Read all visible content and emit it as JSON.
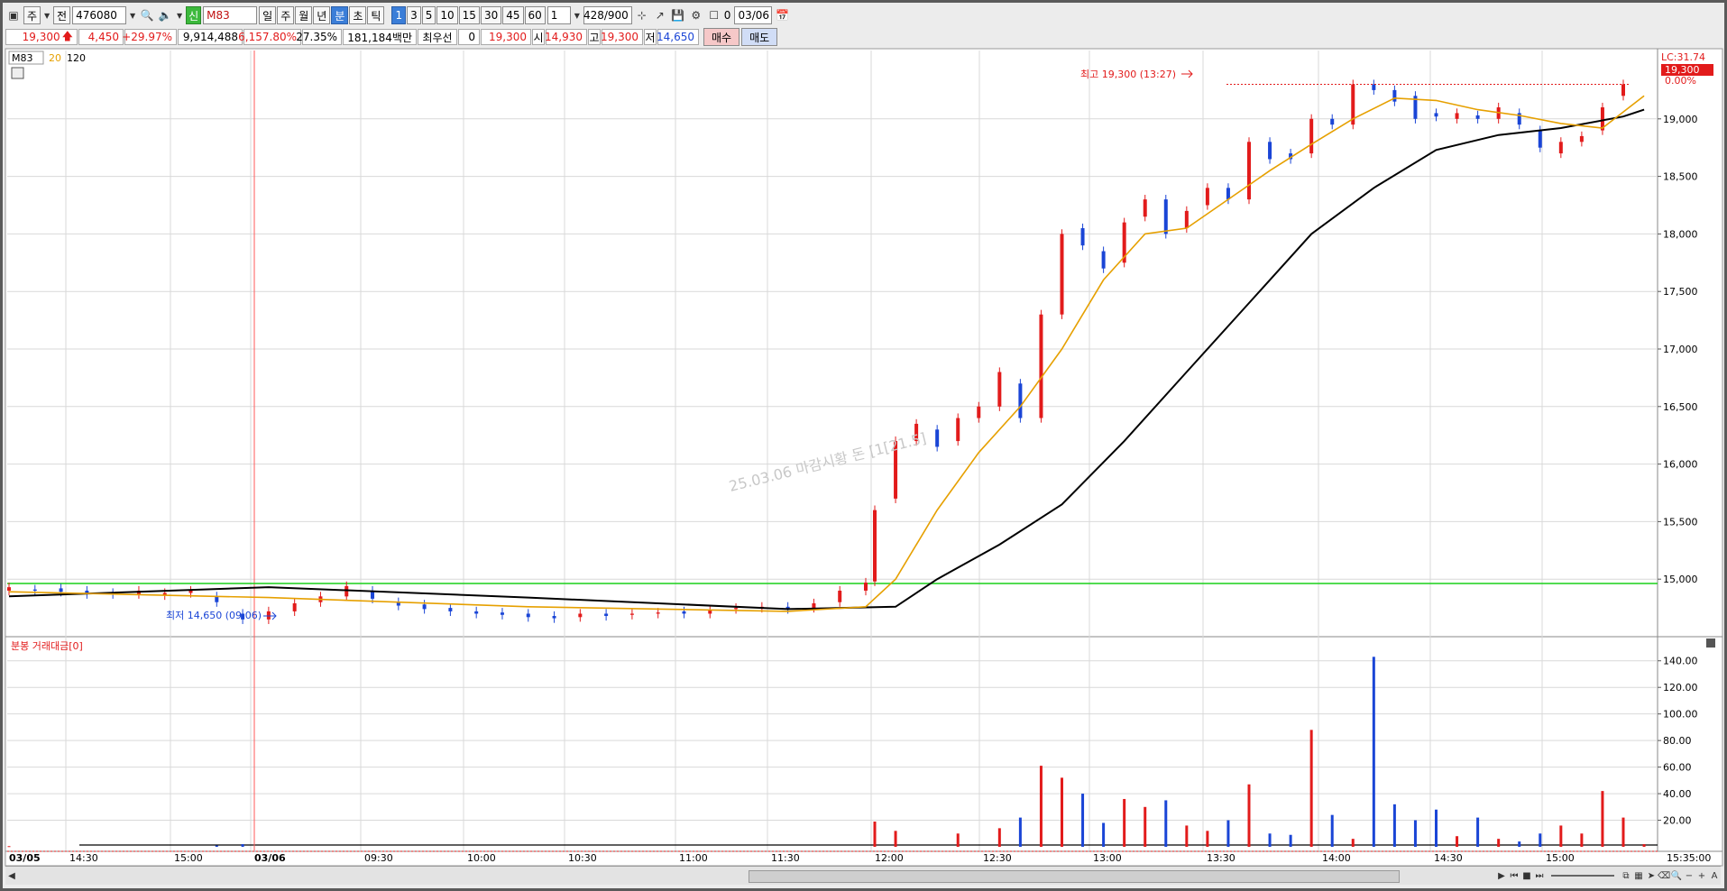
{
  "toolbar": {
    "market_selector": "주",
    "code_prefix": "전",
    "stock_code": "476080",
    "group_badge": "신",
    "group_code": "M83",
    "period_buttons": [
      "일",
      "주",
      "월",
      "년",
      "분",
      "초",
      "틱"
    ],
    "selected_period": "분",
    "interval_buttons": [
      "1",
      "3",
      "5",
      "10",
      "15",
      "30",
      "45",
      "60"
    ],
    "selected_interval": "1",
    "interval_value": "1",
    "count_display": "428/900",
    "checkbox_label": "0",
    "date_value": "03/06"
  },
  "infobar": {
    "price": "19,300",
    "change": "4,450",
    "change_rate": "+29.97%",
    "volume": "9,914,488",
    "volume_ratio": "6,157.80%",
    "turnover_rate": "27.35%",
    "trade_value": "181,184백만",
    "best_bid_label": "최우선",
    "best_bid_qty": "0",
    "best_bid_price": "19,300",
    "open_label": "시",
    "open_price": "14,930",
    "high_label": "고",
    "high_price": "19,300",
    "low_label": "저",
    "low_price": "14,650",
    "buy_button": "매수",
    "sell_button": "매도"
  },
  "legend": {
    "code": "M83",
    "ma_short": "20",
    "ma_long": "120"
  },
  "price_panel": {
    "high_annotation": "최고 19,300 (13:27)",
    "low_annotation": "최저 14,650 (09:06)",
    "watermark": "25.03.06 마감시황 돈 [1[21.5]",
    "lc_label": "LC:31.74",
    "current_price_tag": "19,300",
    "current_rate_tag": "0.00%",
    "y_ticks": [
      "19,000",
      "18,500",
      "18,000",
      "17,500",
      "17,000",
      "16,500",
      "16,000",
      "15,500",
      "15,000"
    ]
  },
  "volume_panel": {
    "title": "분봉 거래대금[0]",
    "y_ticks": [
      "140.00",
      "120.00",
      "100.00",
      "80.00",
      "60.00",
      "40.00",
      "20.00"
    ]
  },
  "x_axis": {
    "labels": [
      "03/05",
      "14:30",
      "15:00",
      "03/06",
      "09:30",
      "10:00",
      "10:30",
      "11:00",
      "11:30",
      "12:00",
      "12:30",
      "13:00",
      "13:30",
      "14:00",
      "14:30",
      "15:00",
      "15:35:00"
    ]
  },
  "colors": {
    "up": "#e21b1b",
    "down": "#1a45d6",
    "ma20": "#e6a000",
    "ma120": "#000000",
    "ref_line": "#19d119",
    "cursor": "#ff5a5a",
    "grid": "#d9d9d9"
  },
  "chart_data": {
    "type": "candlestick",
    "title": "",
    "ylim": [
      14500,
      19500
    ],
    "volume_ylim": [
      0,
      150
    ],
    "x_labels": [
      "03/05",
      "14:30",
      "15:00",
      "03/06",
      "09:30",
      "10:00",
      "10:30",
      "11:00",
      "11:30",
      "12:00",
      "12:30",
      "13:00",
      "13:30",
      "14:00",
      "14:30",
      "15:00"
    ],
    "price_path": [
      [
        14900,
        14930
      ],
      [
        14910,
        14900
      ],
      [
        14920,
        14890
      ],
      [
        14900,
        14870
      ],
      [
        14880,
        14870
      ],
      [
        14870,
        14900
      ],
      [
        14860,
        14880
      ],
      [
        14880,
        14900
      ],
      [
        14850,
        14800
      ],
      [
        14700,
        14650
      ],
      [
        14650,
        14720
      ],
      [
        14720,
        14790
      ],
      [
        14800,
        14850
      ],
      [
        14850,
        14940
      ],
      [
        14900,
        14830
      ],
      [
        14800,
        14770
      ],
      [
        14780,
        14740
      ],
      [
        14750,
        14720
      ],
      [
        14720,
        14700
      ],
      [
        14710,
        14690
      ],
      [
        14700,
        14670
      ],
      [
        14680,
        14660
      ],
      [
        14670,
        14700
      ],
      [
        14700,
        14680
      ],
      [
        14690,
        14700
      ],
      [
        14700,
        14710
      ],
      [
        14720,
        14700
      ],
      [
        14700,
        14730
      ],
      [
        14740,
        14750
      ],
      [
        14750,
        14760
      ],
      [
        14760,
        14740
      ],
      [
        14750,
        14790
      ],
      [
        14800,
        14900
      ],
      [
        14900,
        14970
      ],
      [
        14980,
        15600
      ],
      [
        15700,
        16200
      ],
      [
        16200,
        16350
      ],
      [
        16300,
        16150
      ],
      [
        16200,
        16400
      ],
      [
        16400,
        16500
      ],
      [
        16500,
        16800
      ],
      [
        16700,
        16400
      ],
      [
        16400,
        17300
      ],
      [
        17300,
        18000
      ],
      [
        18050,
        17900
      ],
      [
        17850,
        17700
      ],
      [
        17750,
        18100
      ],
      [
        18150,
        18300
      ],
      [
        18300,
        18000
      ],
      [
        18050,
        18200
      ],
      [
        18250,
        18400
      ],
      [
        18400,
        18300
      ],
      [
        18300,
        18800
      ],
      [
        18800,
        18650
      ],
      [
        18700,
        18650
      ],
      [
        18700,
        19000
      ],
      [
        19000,
        18950
      ],
      [
        18950,
        19300
      ],
      [
        19300,
        19250
      ],
      [
        19250,
        19150
      ],
      [
        19200,
        19000
      ],
      [
        19050,
        19020
      ],
      [
        19000,
        19050
      ],
      [
        19030,
        19000
      ],
      [
        19000,
        19100
      ],
      [
        19050,
        18950
      ],
      [
        18900,
        18750
      ],
      [
        18700,
        18800
      ],
      [
        18800,
        18850
      ],
      [
        18900,
        19100
      ],
      [
        19200,
        19300
      ]
    ],
    "ma20_anchor": [
      [
        0,
        14890
      ],
      [
        10,
        14840
      ],
      [
        20,
        14760
      ],
      [
        30,
        14720
      ],
      [
        33,
        14760
      ],
      [
        35,
        15000
      ],
      [
        37,
        15600
      ],
      [
        39,
        16100
      ],
      [
        41,
        16500
      ],
      [
        43,
        17000
      ],
      [
        45,
        17600
      ],
      [
        47,
        18000
      ],
      [
        49,
        18050
      ],
      [
        51,
        18300
      ],
      [
        53,
        18550
      ],
      [
        55,
        18780
      ],
      [
        57,
        19000
      ],
      [
        59,
        19180
      ],
      [
        61,
        19160
      ],
      [
        63,
        19080
      ],
      [
        65,
        19030
      ],
      [
        67,
        18960
      ],
      [
        69,
        18920
      ],
      [
        71,
        19200
      ]
    ],
    "ma120_anchor": [
      [
        0,
        14850
      ],
      [
        10,
        14930
      ],
      [
        20,
        14840
      ],
      [
        30,
        14740
      ],
      [
        35,
        14760
      ],
      [
        37,
        15000
      ],
      [
        40,
        15300
      ],
      [
        43,
        15650
      ],
      [
        46,
        16200
      ],
      [
        49,
        16800
      ],
      [
        52,
        17400
      ],
      [
        55,
        18000
      ],
      [
        58,
        18400
      ],
      [
        61,
        18730
      ],
      [
        64,
        18860
      ],
      [
        67,
        18920
      ],
      [
        70,
        19020
      ],
      [
        71,
        19080
      ]
    ],
    "volume": [
      [
        0,
        0.5
      ],
      [
        8,
        1
      ],
      [
        9,
        2
      ],
      [
        34,
        19
      ],
      [
        35,
        12
      ],
      [
        38,
        10
      ],
      [
        40,
        14
      ],
      [
        41,
        22
      ],
      [
        42,
        61
      ],
      [
        43,
        52
      ],
      [
        44,
        40
      ],
      [
        45,
        18
      ],
      [
        46,
        36
      ],
      [
        47,
        30
      ],
      [
        48,
        35
      ],
      [
        49,
        16
      ],
      [
        50,
        12
      ],
      [
        51,
        20
      ],
      [
        52,
        47
      ],
      [
        53,
        10
      ],
      [
        54,
        9
      ],
      [
        55,
        88
      ],
      [
        56,
        24
      ],
      [
        57,
        6
      ],
      [
        58,
        143
      ],
      [
        59,
        32
      ],
      [
        60,
        20
      ],
      [
        61,
        28
      ],
      [
        62,
        8
      ],
      [
        63,
        22
      ],
      [
        64,
        6
      ],
      [
        65,
        4
      ],
      [
        66,
        10
      ],
      [
        67,
        16
      ],
      [
        68,
        10
      ],
      [
        69,
        42
      ],
      [
        70,
        22
      ],
      [
        71,
        2
      ]
    ]
  }
}
